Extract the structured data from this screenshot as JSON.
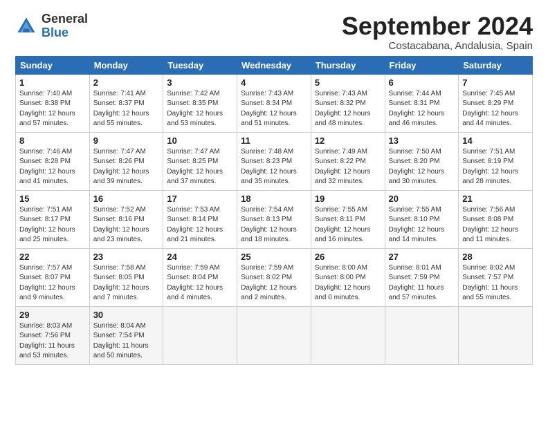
{
  "header": {
    "logo_general": "General",
    "logo_blue": "Blue",
    "month": "September 2024",
    "location": "Costacabana, Andalusia, Spain"
  },
  "weekdays": [
    "Sunday",
    "Monday",
    "Tuesday",
    "Wednesday",
    "Thursday",
    "Friday",
    "Saturday"
  ],
  "weeks": [
    [
      {
        "day": "1",
        "info": "Sunrise: 7:40 AM\nSunset: 8:38 PM\nDaylight: 12 hours\nand 57 minutes."
      },
      {
        "day": "2",
        "info": "Sunrise: 7:41 AM\nSunset: 8:37 PM\nDaylight: 12 hours\nand 55 minutes."
      },
      {
        "day": "3",
        "info": "Sunrise: 7:42 AM\nSunset: 8:35 PM\nDaylight: 12 hours\nand 53 minutes."
      },
      {
        "day": "4",
        "info": "Sunrise: 7:43 AM\nSunset: 8:34 PM\nDaylight: 12 hours\nand 51 minutes."
      },
      {
        "day": "5",
        "info": "Sunrise: 7:43 AM\nSunset: 8:32 PM\nDaylight: 12 hours\nand 48 minutes."
      },
      {
        "day": "6",
        "info": "Sunrise: 7:44 AM\nSunset: 8:31 PM\nDaylight: 12 hours\nand 46 minutes."
      },
      {
        "day": "7",
        "info": "Sunrise: 7:45 AM\nSunset: 8:29 PM\nDaylight: 12 hours\nand 44 minutes."
      }
    ],
    [
      {
        "day": "8",
        "info": "Sunrise: 7:46 AM\nSunset: 8:28 PM\nDaylight: 12 hours\nand 41 minutes."
      },
      {
        "day": "9",
        "info": "Sunrise: 7:47 AM\nSunset: 8:26 PM\nDaylight: 12 hours\nand 39 minutes."
      },
      {
        "day": "10",
        "info": "Sunrise: 7:47 AM\nSunset: 8:25 PM\nDaylight: 12 hours\nand 37 minutes."
      },
      {
        "day": "11",
        "info": "Sunrise: 7:48 AM\nSunset: 8:23 PM\nDaylight: 12 hours\nand 35 minutes."
      },
      {
        "day": "12",
        "info": "Sunrise: 7:49 AM\nSunset: 8:22 PM\nDaylight: 12 hours\nand 32 minutes."
      },
      {
        "day": "13",
        "info": "Sunrise: 7:50 AM\nSunset: 8:20 PM\nDaylight: 12 hours\nand 30 minutes."
      },
      {
        "day": "14",
        "info": "Sunrise: 7:51 AM\nSunset: 8:19 PM\nDaylight: 12 hours\nand 28 minutes."
      }
    ],
    [
      {
        "day": "15",
        "info": "Sunrise: 7:51 AM\nSunset: 8:17 PM\nDaylight: 12 hours\nand 25 minutes."
      },
      {
        "day": "16",
        "info": "Sunrise: 7:52 AM\nSunset: 8:16 PM\nDaylight: 12 hours\nand 23 minutes."
      },
      {
        "day": "17",
        "info": "Sunrise: 7:53 AM\nSunset: 8:14 PM\nDaylight: 12 hours\nand 21 minutes."
      },
      {
        "day": "18",
        "info": "Sunrise: 7:54 AM\nSunset: 8:13 PM\nDaylight: 12 hours\nand 18 minutes."
      },
      {
        "day": "19",
        "info": "Sunrise: 7:55 AM\nSunset: 8:11 PM\nDaylight: 12 hours\nand 16 minutes."
      },
      {
        "day": "20",
        "info": "Sunrise: 7:55 AM\nSunset: 8:10 PM\nDaylight: 12 hours\nand 14 minutes."
      },
      {
        "day": "21",
        "info": "Sunrise: 7:56 AM\nSunset: 8:08 PM\nDaylight: 12 hours\nand 11 minutes."
      }
    ],
    [
      {
        "day": "22",
        "info": "Sunrise: 7:57 AM\nSunset: 8:07 PM\nDaylight: 12 hours\nand 9 minutes."
      },
      {
        "day": "23",
        "info": "Sunrise: 7:58 AM\nSunset: 8:05 PM\nDaylight: 12 hours\nand 7 minutes."
      },
      {
        "day": "24",
        "info": "Sunrise: 7:59 AM\nSunset: 8:04 PM\nDaylight: 12 hours\nand 4 minutes."
      },
      {
        "day": "25",
        "info": "Sunrise: 7:59 AM\nSunset: 8:02 PM\nDaylight: 12 hours\nand 2 minutes."
      },
      {
        "day": "26",
        "info": "Sunrise: 8:00 AM\nSunset: 8:00 PM\nDaylight: 12 hours\nand 0 minutes."
      },
      {
        "day": "27",
        "info": "Sunrise: 8:01 AM\nSunset: 7:59 PM\nDaylight: 11 hours\nand 57 minutes."
      },
      {
        "day": "28",
        "info": "Sunrise: 8:02 AM\nSunset: 7:57 PM\nDaylight: 11 hours\nand 55 minutes."
      }
    ],
    [
      {
        "day": "29",
        "info": "Sunrise: 8:03 AM\nSunset: 7:56 PM\nDaylight: 11 hours\nand 53 minutes."
      },
      {
        "day": "30",
        "info": "Sunrise: 8:04 AM\nSunset: 7:54 PM\nDaylight: 11 hours\nand 50 minutes."
      },
      {
        "day": "",
        "info": ""
      },
      {
        "day": "",
        "info": ""
      },
      {
        "day": "",
        "info": ""
      },
      {
        "day": "",
        "info": ""
      },
      {
        "day": "",
        "info": ""
      }
    ]
  ]
}
